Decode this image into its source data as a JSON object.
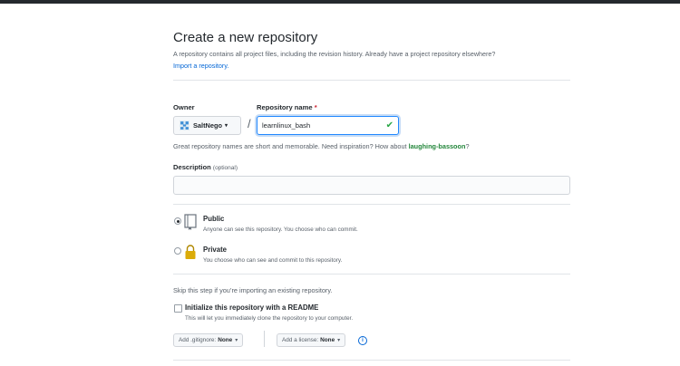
{
  "header": {
    "title": "Create a new repository",
    "subtitle": "A repository contains all project files, including the revision history. Already have a project repository elsewhere?",
    "import_link": "Import a repository."
  },
  "owner": {
    "label": "Owner",
    "value": "SaltNego",
    "avatar_icon": "identicon"
  },
  "repo_name": {
    "label": "Repository name",
    "required_mark": "*",
    "value": "learnlinux_bash",
    "valid": true,
    "separator": "/"
  },
  "hint": {
    "text": "Great repository names are short and memorable. Need inspiration? How about",
    "suggestion": "laughing-bassoon",
    "end": "?"
  },
  "description": {
    "label": "Description",
    "optional": "(optional)",
    "value": ""
  },
  "visibility": {
    "selected": "public",
    "options": [
      {
        "title": "Public",
        "desc": "Anyone can see this repository. You choose who can commit.",
        "icon": "repo-book-icon"
      },
      {
        "title": "Private",
        "desc": "You choose who can see and commit to this repository.",
        "icon": "lock-icon"
      }
    ]
  },
  "init": {
    "skip_text": "Skip this step if you’re importing an existing repository.",
    "readme_label": "Initialize this repository with a README",
    "readme_desc": "This will let you immediately clone the repository to your computer.",
    "readme_checked": false
  },
  "dropdowns": {
    "gitignore_prefix": "Add .gitignore:",
    "gitignore_value": "None",
    "license_prefix": "Add a license:",
    "license_value": "None",
    "caret": "▾",
    "info_glyph": "i"
  },
  "colors": {
    "topbar": "#24292e",
    "link": "#0366d6",
    "success": "#28a745",
    "suggestion": "#22863a",
    "required": "#cb2431"
  }
}
